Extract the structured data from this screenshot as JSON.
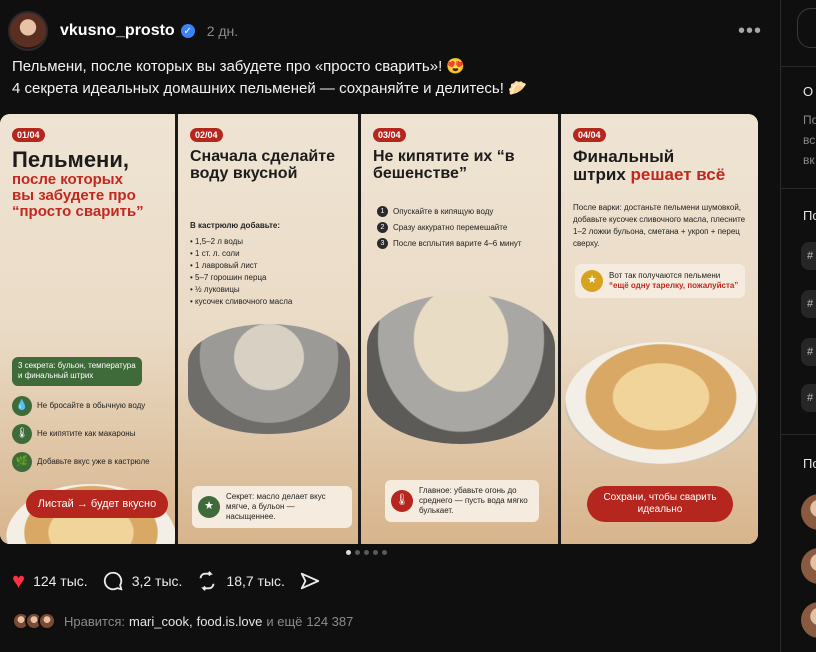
{
  "post": {
    "username": "vkusno_prosto",
    "time": "2 дн.",
    "more": "•••",
    "caption_line1": "Пельмени, после которых вы забудете про «просто сварить»! 😍",
    "caption_line2": "4 секрета идеальных домашних пельменей — сохраняйте и делитесь! 🥟"
  },
  "slides": [
    {
      "tag": "01/04",
      "title1": "Пельмени,",
      "title2": "после которых",
      "title3": "вы забудете про",
      "title4": "“просто сварить”",
      "chip": "3 секрета: бульон, температура и финальный штрих",
      "tips": [
        "Не бросайте в обычную воду",
        "Не кипятите как макароны",
        "Добавьте вкус уже в кастрюле"
      ],
      "cta": "Листай → будет вкусно"
    },
    {
      "tag": "02/04",
      "title": "Сначала сделайте воду вкусной",
      "list_head": "В кастрюлю добавьте:",
      "list": [
        "1,5–2 л воды",
        "1 ст. л. соли",
        "1 лавровый лист",
        "5–7 горошин перца",
        "½ луковицы",
        "кусочек сливочного масла"
      ],
      "note": "Секрет: масло делает вкус мягче, а бульон — насыщеннее."
    },
    {
      "tag": "03/04",
      "title": "Не кипятите их “в бешенстве”",
      "steps": [
        "Опускайте в кипящую воду",
        "Сразу аккуратно перемешайте",
        "После всплытия варите 4–6 минут"
      ],
      "note": "Главное: убавьте огонь до среднего — пусть вода мягко булькает."
    },
    {
      "tag": "04/04",
      "title_a": "Финальный",
      "title_b": "штрих",
      "title_c": "решает всё",
      "body": "После варки: достаньте пельмени шумовкой, добавьте кусочек сливочного масла, плесните 1–2 ложки бульона, сметана + укроп + перец сверху.",
      "note1": "Вот так получаются пельмени",
      "note2": "“ещё одну тарелку, пожалуйста”",
      "cta": "Сохрани, чтобы сварить идеально"
    }
  ],
  "actions": {
    "likes": "124 тыс.",
    "comments": "3,2 тыс.",
    "reposts": "18,7 тыс."
  },
  "liked_by": {
    "prefix": "Нравится:",
    "user1": "mari_cook",
    "user2": "food.is.love",
    "suffix": "и ещё",
    "count": "124 387"
  },
  "sidebar": {
    "t1": "О",
    "g1": "По",
    "g2": "вс",
    "g3": "вк",
    "t2": "По",
    "chips": [
      "#",
      "#",
      "#",
      "#"
    ],
    "t3": "По"
  },
  "icons": [
    "verified-icon",
    "more-icon",
    "heart-icon",
    "comment-icon",
    "repost-icon",
    "share-icon"
  ],
  "colors": {
    "accent_red": "#b5261e",
    "heart": "#ff3040",
    "green": "#3f6b3a"
  }
}
